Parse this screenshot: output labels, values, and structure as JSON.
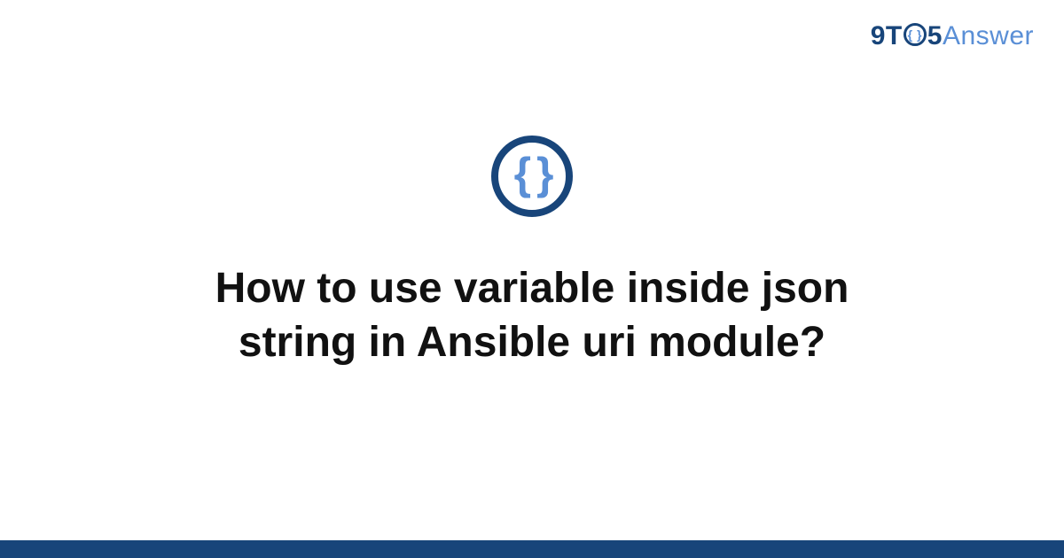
{
  "logo": {
    "part1": "9T",
    "part_o_inner": "{ }",
    "part2": "5",
    "part3": "Answer"
  },
  "icon": {
    "name": "braces-icon",
    "glyph": "{ }"
  },
  "title": "How to use variable inside json string in Ansible uri module?",
  "colors": {
    "primary": "#18457a",
    "accent": "#5a8fd6"
  }
}
